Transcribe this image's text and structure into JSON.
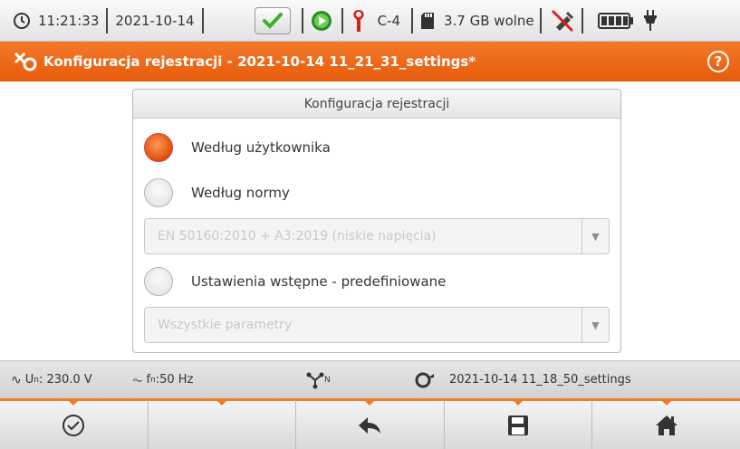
{
  "statusbar": {
    "time": "11:21:33",
    "date": "2021-10-14",
    "clamp_label": "C-4",
    "memory_label": "3.7 GB wolne",
    "icons": [
      "clock-icon",
      "check-icon",
      "record-icon",
      "clamp-icon",
      "sd-card-icon",
      "no-usb-icon",
      "battery-icon",
      "power-plug-icon"
    ]
  },
  "titlebar": {
    "title": "Konfiguracja rejestracji - 2021-10-14 11_21_31_settings*",
    "help": "?"
  },
  "panel": {
    "header": "Konfiguracja rejestracji",
    "options": [
      {
        "label": "Według użytkownika",
        "selected": true
      },
      {
        "label": "Według normy",
        "selected": false
      },
      {
        "label": "Ustawienia wstępne - predefiniowane",
        "selected": false
      }
    ],
    "norm_dropdown": "EN 50160:2010 + A3:2019 (niskie napięcia)",
    "preset_dropdown": "Wszystkie parametry"
  },
  "infobar": {
    "voltage_prefix": "U",
    "voltage_sub": "n",
    "voltage_value": ": 230.0 V",
    "freq_prefix": "f",
    "freq_sub": "n",
    "freq_value": ":50 Hz",
    "network_sub": "N",
    "settings_file": "2021-10-14 11_18_50_settings"
  },
  "bottombar": {
    "icons": [
      "check-circle-icon",
      "",
      "back-arrow-icon",
      "save-icon",
      "home-icon"
    ]
  },
  "colors": {
    "accent": "#e8600f",
    "selected_radio": "#f06a1c",
    "check_green": "#3fae2a"
  }
}
